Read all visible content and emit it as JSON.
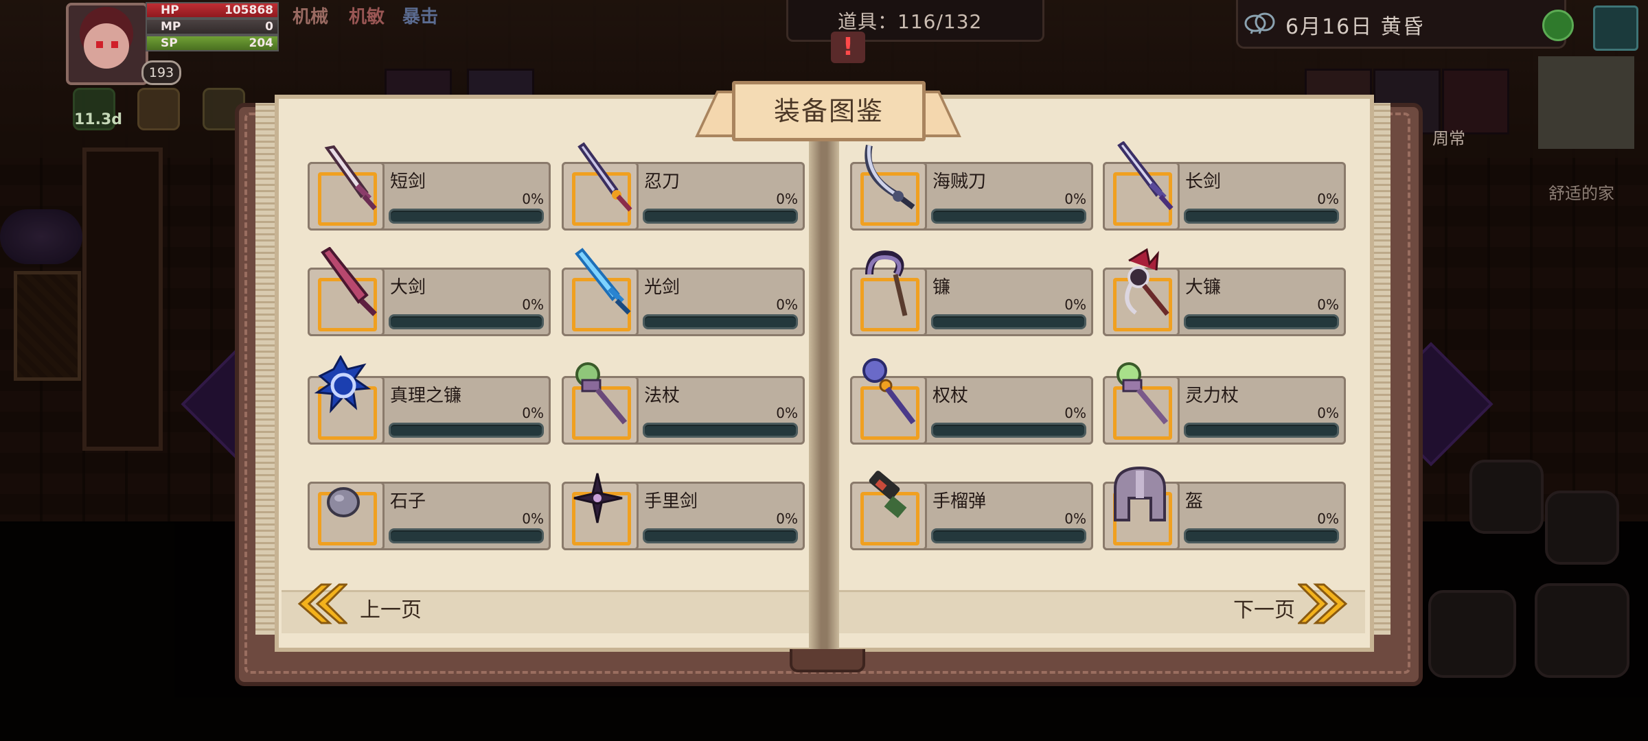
{
  "hud": {
    "hp_label": "HP",
    "hp_value": "105868",
    "mp_label": "MP",
    "mp_value": "0",
    "sp_label": "SP",
    "sp_value": "204",
    "level": "193",
    "tag_1": "机械",
    "tag_2": "机敏",
    "tag_3": "暴击",
    "buff_time": "11.3d",
    "items_label": "道具：116/132",
    "date_text": "6月16日  黄昏",
    "daily_label": "周常",
    "home_label": "舒适的家"
  },
  "book": {
    "title": "装备图鉴",
    "prev_label": "上一页",
    "next_label": "下一页",
    "entries": [
      {
        "name": "短剑",
        "percent": "0%",
        "progress": 0,
        "icon": "short-sword-icon"
      },
      {
        "name": "忍刀",
        "percent": "0%",
        "progress": 0,
        "icon": "ninja-blade-icon"
      },
      {
        "name": "海贼刀",
        "percent": "0%",
        "progress": 0,
        "icon": "pirate-sabre-icon"
      },
      {
        "name": "长剑",
        "percent": "0%",
        "progress": 0,
        "icon": "long-sword-icon"
      },
      {
        "name": "大剑",
        "percent": "0%",
        "progress": 0,
        "icon": "great-sword-icon"
      },
      {
        "name": "光剑",
        "percent": "0%",
        "progress": 0,
        "icon": "light-sword-icon"
      },
      {
        "name": "镰",
        "percent": "0%",
        "progress": 0,
        "icon": "sickle-icon"
      },
      {
        "name": "大镰",
        "percent": "0%",
        "progress": 0,
        "icon": "great-scythe-icon"
      },
      {
        "name": "真理之镰",
        "percent": "0%",
        "progress": 0,
        "icon": "truth-scythe-icon"
      },
      {
        "name": "法杖",
        "percent": "0%",
        "progress": 0,
        "icon": "magic-staff-icon"
      },
      {
        "name": "权杖",
        "percent": "0%",
        "progress": 0,
        "icon": "scepter-icon"
      },
      {
        "name": "灵力杖",
        "percent": "0%",
        "progress": 0,
        "icon": "spirit-staff-icon"
      },
      {
        "name": "石子",
        "percent": "0%",
        "progress": 0,
        "icon": "stone-icon"
      },
      {
        "name": "手里剑",
        "percent": "0%",
        "progress": 0,
        "icon": "shuriken-icon"
      },
      {
        "name": "手榴弹",
        "percent": "0%",
        "progress": 0,
        "icon": "grenade-icon"
      },
      {
        "name": "盔",
        "percent": "0%",
        "progress": 0,
        "icon": "helmet-icon"
      }
    ]
  },
  "colors": {
    "frame_orange": "#f0a020",
    "bar_track": "#24383c",
    "page": "#efe4cd",
    "book_cover": "#6e4a40"
  }
}
